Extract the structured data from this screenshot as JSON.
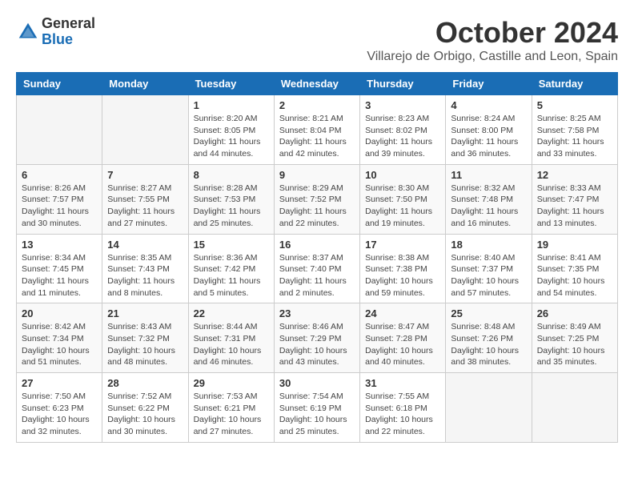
{
  "logo": {
    "general": "General",
    "blue": "Blue"
  },
  "title": "October 2024",
  "subtitle": "Villarejo de Orbigo, Castille and Leon, Spain",
  "weekdays": [
    "Sunday",
    "Monday",
    "Tuesday",
    "Wednesday",
    "Thursday",
    "Friday",
    "Saturday"
  ],
  "weeks": [
    [
      {
        "day": "",
        "detail": ""
      },
      {
        "day": "",
        "detail": ""
      },
      {
        "day": "1",
        "detail": "Sunrise: 8:20 AM\nSunset: 8:05 PM\nDaylight: 11 hours and 44 minutes."
      },
      {
        "day": "2",
        "detail": "Sunrise: 8:21 AM\nSunset: 8:04 PM\nDaylight: 11 hours and 42 minutes."
      },
      {
        "day": "3",
        "detail": "Sunrise: 8:23 AM\nSunset: 8:02 PM\nDaylight: 11 hours and 39 minutes."
      },
      {
        "day": "4",
        "detail": "Sunrise: 8:24 AM\nSunset: 8:00 PM\nDaylight: 11 hours and 36 minutes."
      },
      {
        "day": "5",
        "detail": "Sunrise: 8:25 AM\nSunset: 7:58 PM\nDaylight: 11 hours and 33 minutes."
      }
    ],
    [
      {
        "day": "6",
        "detail": "Sunrise: 8:26 AM\nSunset: 7:57 PM\nDaylight: 11 hours and 30 minutes."
      },
      {
        "day": "7",
        "detail": "Sunrise: 8:27 AM\nSunset: 7:55 PM\nDaylight: 11 hours and 27 minutes."
      },
      {
        "day": "8",
        "detail": "Sunrise: 8:28 AM\nSunset: 7:53 PM\nDaylight: 11 hours and 25 minutes."
      },
      {
        "day": "9",
        "detail": "Sunrise: 8:29 AM\nSunset: 7:52 PM\nDaylight: 11 hours and 22 minutes."
      },
      {
        "day": "10",
        "detail": "Sunrise: 8:30 AM\nSunset: 7:50 PM\nDaylight: 11 hours and 19 minutes."
      },
      {
        "day": "11",
        "detail": "Sunrise: 8:32 AM\nSunset: 7:48 PM\nDaylight: 11 hours and 16 minutes."
      },
      {
        "day": "12",
        "detail": "Sunrise: 8:33 AM\nSunset: 7:47 PM\nDaylight: 11 hours and 13 minutes."
      }
    ],
    [
      {
        "day": "13",
        "detail": "Sunrise: 8:34 AM\nSunset: 7:45 PM\nDaylight: 11 hours and 11 minutes."
      },
      {
        "day": "14",
        "detail": "Sunrise: 8:35 AM\nSunset: 7:43 PM\nDaylight: 11 hours and 8 minutes."
      },
      {
        "day": "15",
        "detail": "Sunrise: 8:36 AM\nSunset: 7:42 PM\nDaylight: 11 hours and 5 minutes."
      },
      {
        "day": "16",
        "detail": "Sunrise: 8:37 AM\nSunset: 7:40 PM\nDaylight: 11 hours and 2 minutes."
      },
      {
        "day": "17",
        "detail": "Sunrise: 8:38 AM\nSunset: 7:38 PM\nDaylight: 10 hours and 59 minutes."
      },
      {
        "day": "18",
        "detail": "Sunrise: 8:40 AM\nSunset: 7:37 PM\nDaylight: 10 hours and 57 minutes."
      },
      {
        "day": "19",
        "detail": "Sunrise: 8:41 AM\nSunset: 7:35 PM\nDaylight: 10 hours and 54 minutes."
      }
    ],
    [
      {
        "day": "20",
        "detail": "Sunrise: 8:42 AM\nSunset: 7:34 PM\nDaylight: 10 hours and 51 minutes."
      },
      {
        "day": "21",
        "detail": "Sunrise: 8:43 AM\nSunset: 7:32 PM\nDaylight: 10 hours and 48 minutes."
      },
      {
        "day": "22",
        "detail": "Sunrise: 8:44 AM\nSunset: 7:31 PM\nDaylight: 10 hours and 46 minutes."
      },
      {
        "day": "23",
        "detail": "Sunrise: 8:46 AM\nSunset: 7:29 PM\nDaylight: 10 hours and 43 minutes."
      },
      {
        "day": "24",
        "detail": "Sunrise: 8:47 AM\nSunset: 7:28 PM\nDaylight: 10 hours and 40 minutes."
      },
      {
        "day": "25",
        "detail": "Sunrise: 8:48 AM\nSunset: 7:26 PM\nDaylight: 10 hours and 38 minutes."
      },
      {
        "day": "26",
        "detail": "Sunrise: 8:49 AM\nSunset: 7:25 PM\nDaylight: 10 hours and 35 minutes."
      }
    ],
    [
      {
        "day": "27",
        "detail": "Sunrise: 7:50 AM\nSunset: 6:23 PM\nDaylight: 10 hours and 32 minutes."
      },
      {
        "day": "28",
        "detail": "Sunrise: 7:52 AM\nSunset: 6:22 PM\nDaylight: 10 hours and 30 minutes."
      },
      {
        "day": "29",
        "detail": "Sunrise: 7:53 AM\nSunset: 6:21 PM\nDaylight: 10 hours and 27 minutes."
      },
      {
        "day": "30",
        "detail": "Sunrise: 7:54 AM\nSunset: 6:19 PM\nDaylight: 10 hours and 25 minutes."
      },
      {
        "day": "31",
        "detail": "Sunrise: 7:55 AM\nSunset: 6:18 PM\nDaylight: 10 hours and 22 minutes."
      },
      {
        "day": "",
        "detail": ""
      },
      {
        "day": "",
        "detail": ""
      }
    ]
  ]
}
